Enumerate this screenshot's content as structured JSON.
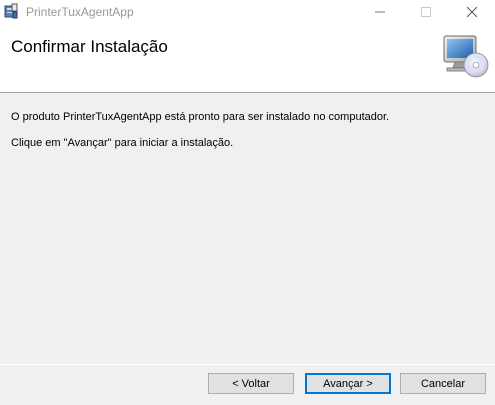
{
  "window": {
    "title": "PrinterTuxAgentApp",
    "controls": {
      "minimize_icon": "minimize-icon",
      "maximize_icon": "maximize-icon",
      "close_icon": "close-icon"
    }
  },
  "banner": {
    "title": "Confirmar Instalação",
    "icon": "computer-cd-icon"
  },
  "body": {
    "line1": "O produto PrinterTuxAgentApp está pronto para ser instalado no computador.",
    "line2": "Clique em \"Avançar\" para iniciar a instalação."
  },
  "buttons": {
    "back": "< Voltar",
    "next": "Avançar >",
    "cancel": "Cancelar"
  },
  "colors": {
    "focus_border": "#0078d7",
    "dialog_background": "#f0f0f0"
  }
}
